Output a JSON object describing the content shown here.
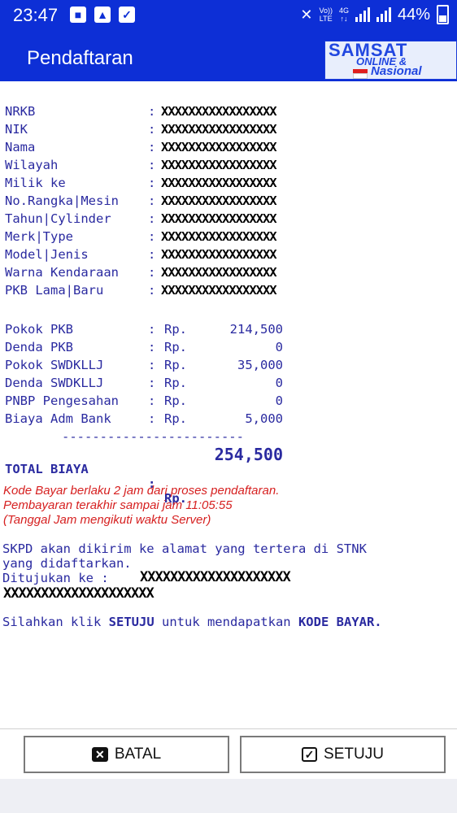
{
  "status": {
    "time": "23:47",
    "volte_top": "Vo))",
    "volte_bottom": "LTE",
    "net_top": "4G",
    "net_bottom": "↑↓",
    "battery": "44%"
  },
  "appbar": {
    "title": "Pendaftaran",
    "logo_line1": "SAMSAT",
    "logo_line2": "ONLINE &",
    "logo_line3": "Nasional"
  },
  "mask": "XXXXXXXXXXXXXXXXX",
  "vehicle_fields": [
    {
      "label": "NRKB",
      "sep": ":"
    },
    {
      "label": "NIK",
      "sep": ":"
    },
    {
      "label": "Nama",
      "sep": ":"
    },
    {
      "label": "Wilayah",
      "sep": ":"
    },
    {
      "label": "Milik ke",
      "sep": ":"
    },
    {
      "label": "No.Rangka|Mesin",
      "sep": ":"
    },
    {
      "label": "Tahun|Cylinder",
      "sep": ":"
    },
    {
      "label": "Merk|Type",
      "sep": ":"
    },
    {
      "label": "Model|Jenis",
      "sep": ":"
    },
    {
      "label": "Warna Kendaraan",
      "sep": ":"
    },
    {
      "label": "PKB Lama|Baru",
      "sep": ":"
    }
  ],
  "costs": [
    {
      "label": "Pokok PKB",
      "sep": ":",
      "cur": "Rp.",
      "amount": "214,500"
    },
    {
      "label": "Denda PKB",
      "sep": ":",
      "cur": "Rp.",
      "amount": "0"
    },
    {
      "label": "Pokok SWDKLLJ",
      "sep": ":",
      "cur": "Rp.",
      "amount": "35,000"
    },
    {
      "label": "Denda SWDKLLJ",
      "sep": ":",
      "cur": "Rp.",
      "amount": "0"
    },
    {
      "label": "PNBP Pengesahan",
      "sep": ":",
      "cur": "Rp.",
      "amount": "0"
    },
    {
      "label": "Biaya Adm Bank",
      "sep": ":",
      "cur": "Rp.",
      "amount": "5,000"
    }
  ],
  "divider": "------------------------",
  "total": {
    "label": "TOTAL BIAYA",
    "sep": ":",
    "cur": "Rp.",
    "amount": "254,500"
  },
  "notice": {
    "line1": "Kode Bayar berlaku 2 jam dari proses pendaftaran.",
    "line2": "Pembayaran terakhir sampai jam 11:05:55",
    "line3": "(Tanggal Jam mengikuti waktu Server)"
  },
  "skpd": {
    "line1": "SKPD akan dikirim ke alamat yang tertera di STNK",
    "line2": "yang didaftarkan.",
    "line3_prefix": "Ditujukan ke : ",
    "mask_line3": "XXXXXXXXXXXXXXXXXXXX",
    "mask_line4": "XXXXXXXXXXXXXXXXXXXX"
  },
  "instruction": {
    "prefix": "Silahkan klik ",
    "bold1": "SETUJU",
    "middle": " untuk mendapatkan ",
    "bold2": "KODE BAYAR."
  },
  "buttons": {
    "cancel": "BATAL",
    "cancel_icon": "close-icon",
    "ok": "SETUJU",
    "ok_icon": "checkbox-icon"
  },
  "colors": {
    "brand": "#0d2fd6",
    "text_blue": "#2a2aa0",
    "notice_red": "#d62020"
  }
}
